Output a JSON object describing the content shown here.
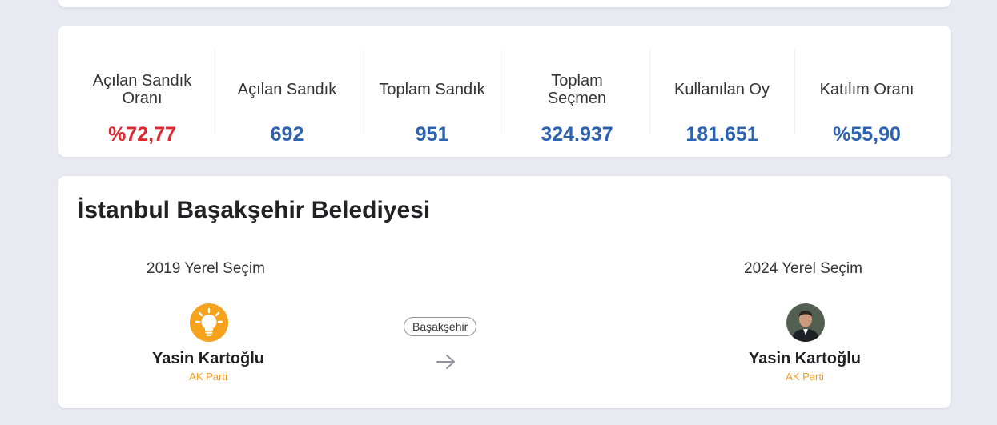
{
  "stats": [
    {
      "label": "Açılan Sandık Oranı",
      "value": "%72,77"
    },
    {
      "label": "Açılan Sandık",
      "value": "692"
    },
    {
      "label": "Toplam Sandık",
      "value": "951"
    },
    {
      "label": "Toplam Seçmen",
      "value": "324.937"
    },
    {
      "label": "Kullanılan Oy",
      "value": "181.651"
    },
    {
      "label": "Katılım Oranı",
      "value": "%55,90"
    }
  ],
  "race": {
    "title": "İstanbul Başakşehir Belediyesi",
    "district": "Başakşehir",
    "previous": {
      "election": "2019 Yerel Seçim",
      "candidate": "Yasin Kartoğlu",
      "party": "AK Parti",
      "icon": "party-logo-icon"
    },
    "current": {
      "election": "2024 Yerel Seçim",
      "candidate": "Yasin Kartoğlu",
      "party": "AK Parti",
      "icon": "candidate-avatar"
    },
    "transition_icon": "arrow-right-icon"
  },
  "colors": {
    "value_blue": "#2c62b0",
    "value_red": "#e0262f",
    "party_orange": "#f29b1e",
    "background": "#e9e9f2"
  }
}
